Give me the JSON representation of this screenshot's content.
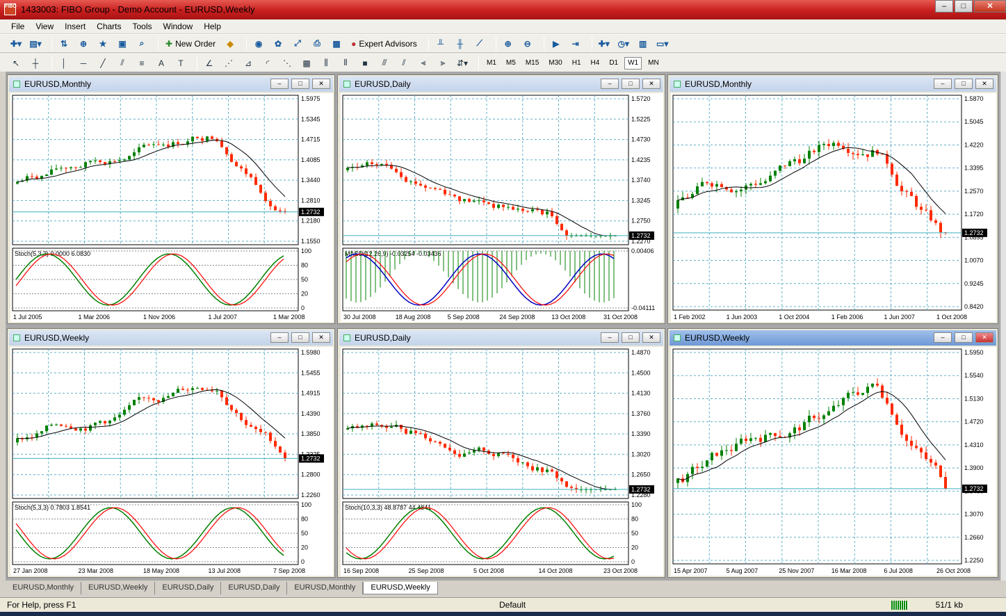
{
  "app": {
    "title": "1433003: FIBO Group - Demo Account - EURUSD,Weekly",
    "icon_label": "FIBO",
    "win_minimize": "–",
    "win_restore": "□",
    "win_close": "✕"
  },
  "menu": [
    "File",
    "View",
    "Insert",
    "Charts",
    "Tools",
    "Window",
    "Help"
  ],
  "toolbar": {
    "new_order": "New Order",
    "expert_advisors": "Expert Advisors",
    "timeframes": [
      "M1",
      "M5",
      "M15",
      "M30",
      "H1",
      "H4",
      "D1",
      "W1",
      "MN"
    ],
    "active_timeframe": "W1"
  },
  "windows": [
    {
      "title": "EURUSD,Monthly",
      "price_labels": [
        "1.5975",
        "1.5345",
        "1.4715",
        "1.4085",
        "1.3440",
        "1.2810",
        "1.2180",
        "1.1550"
      ],
      "current": "1.2732",
      "indicator": "Stoch(5,3,3) 0.0000 6.0830",
      "ind_labels": [
        "100",
        "80",
        "50",
        "20",
        "0"
      ],
      "dates": [
        "1 Jul 2005",
        "1 Mar 2006",
        "1 Nov 2006",
        "1 Jul 2007",
        "1 Mar 2008"
      ]
    },
    {
      "title": "EURUSD,Daily",
      "price_labels": [
        "1.5720",
        "1.5225",
        "1.4730",
        "1.4235",
        "1.3740",
        "1.3245",
        "1.2750",
        "1.2270"
      ],
      "current": "1.2732",
      "indicator": "MACD(12,26,9) -0.03254 -0.03436",
      "ind_labels": [
        "0.00406",
        "-0.04111"
      ],
      "dates": [
        "30 Jul 2008",
        "18 Aug 2008",
        "5 Sep 2008",
        "24 Sep 2008",
        "13 Oct 2008",
        "31 Oct 2008"
      ]
    },
    {
      "title": "EURUSD,Monthly",
      "price_labels": [
        "1.5870",
        "1.5045",
        "1.4220",
        "1.3395",
        "1.2570",
        "1.1720",
        "1.0895",
        "1.0070",
        "0.9245",
        "0.8420"
      ],
      "current": "1.2732",
      "dates": [
        "1 Feb 2002",
        "1 Jun 2003",
        "1 Oct 2004",
        "1 Feb 2006",
        "1 Jun 2007",
        "1 Oct 2008"
      ]
    },
    {
      "title": "EURUSD,Weekly",
      "price_labels": [
        "1.5980",
        "1.5455",
        "1.4915",
        "1.4390",
        "1.3850",
        "1.3325",
        "1.2800",
        "1.2260"
      ],
      "current": "1.2732",
      "indicator": "Stoch(5,3,3) 0.7803 1.8541",
      "ind_labels": [
        "100",
        "80",
        "50",
        "20",
        "0"
      ],
      "dates": [
        "27 Jan 2008",
        "23 Mar 2008",
        "18 May 2008",
        "13 Jul 2008",
        "7 Sep 2008"
      ]
    },
    {
      "title": "EURUSD,Daily",
      "price_labels": [
        "1.4870",
        "1.4500",
        "1.4130",
        "1.3760",
        "1.3390",
        "1.3020",
        "1.2650",
        "1.2280"
      ],
      "current": "1.2732",
      "indicator": "Stoch(10,3,3) 48.8787 44.4841",
      "ind_labels": [
        "100",
        "80",
        "50",
        "20",
        "0"
      ],
      "dates": [
        "16 Sep 2008",
        "25 Sep 2008",
        "5 Oct 2008",
        "14 Oct 2008",
        "23 Oct 2008"
      ]
    },
    {
      "title": "EURUSD,Weekly",
      "price_labels": [
        "1.5950",
        "1.5540",
        "1.5130",
        "1.4720",
        "1.4310",
        "1.3900",
        "1.3480",
        "1.3070",
        "1.2660",
        "1.2250"
      ],
      "current": "1.2732",
      "dates": [
        "15 Apr 2007",
        "5 Aug 2007",
        "25 Nov 2007",
        "16 Mar 2008",
        "6 Jul 2008",
        "26 Oct 2008"
      ]
    }
  ],
  "tabs": [
    "EURUSD,Monthly",
    "EURUSD,Weekly",
    "EURUSD,Daily",
    "EURUSD,Daily",
    "EURUSD,Monthly",
    "EURUSD,Weekly"
  ],
  "active_tab": 5,
  "status": {
    "help": "For Help, press F1",
    "profile": "Default",
    "traffic": "51/1 kb"
  },
  "colors": {
    "bull": "#008000",
    "bear": "#ff2a00",
    "grid": "#5fb0c8",
    "price_line": "#3fb0c0"
  }
}
